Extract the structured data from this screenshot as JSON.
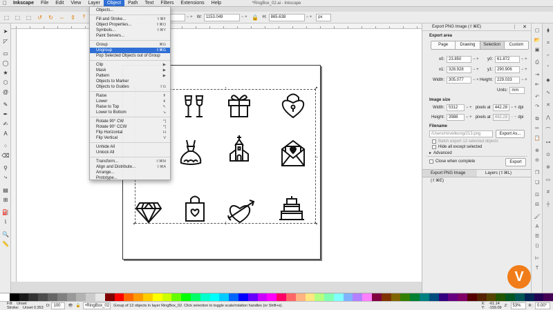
{
  "menubar": {
    "app": "Inkscape",
    "items": [
      "File",
      "Edit",
      "View",
      "Layer",
      "Object",
      "Path",
      "Text",
      "Filters",
      "Extensions",
      "Help"
    ],
    "active": "Object",
    "window_title": "*RingBox_02.ai - Inkscape"
  },
  "controls": {
    "x": "233.848",
    "w_label": "W:",
    "w": "1153.049",
    "h_label": "H:",
    "h": "865.638",
    "unit": "px"
  },
  "object_menu": [
    {
      "label": "Objects...",
      "shortcut": ""
    },
    {
      "sep": true
    },
    {
      "label": "Fill and Stroke...",
      "shortcut": "⇧⌘F"
    },
    {
      "label": "Object Properties...",
      "shortcut": "⇧⌘O"
    },
    {
      "label": "Symbols...",
      "shortcut": "⇧⌘Y"
    },
    {
      "label": "Paint Servers...",
      "shortcut": ""
    },
    {
      "sep": true
    },
    {
      "label": "Group",
      "shortcut": "⌘G"
    },
    {
      "label": "Ungroup",
      "shortcut": "⇧⌘G"
    },
    {
      "label": "Pop Selected Objects out of Group",
      "shortcut": ""
    },
    {
      "sep": true
    },
    {
      "label": "Clip",
      "shortcut": "▶"
    },
    {
      "label": "Mask",
      "shortcut": "▶"
    },
    {
      "label": "Pattern",
      "shortcut": "▶"
    },
    {
      "label": "Objects to Marker",
      "shortcut": ""
    },
    {
      "label": "Objects to Guides",
      "shortcut": "⇧G"
    },
    {
      "sep": true
    },
    {
      "label": "Raise",
      "shortcut": "⇞"
    },
    {
      "label": "Lower",
      "shortcut": "⇟"
    },
    {
      "label": "Raise to Top",
      "shortcut": "↖"
    },
    {
      "label": "Lower to Bottom",
      "shortcut": "↘"
    },
    {
      "sep": true
    },
    {
      "label": "Rotate 90° CW",
      "shortcut": "^]"
    },
    {
      "label": "Rotate 90° CCW",
      "shortcut": "^["
    },
    {
      "label": "Flip Horizontal",
      "shortcut": "H"
    },
    {
      "label": "Flip Vertical",
      "shortcut": "V"
    },
    {
      "sep": true
    },
    {
      "label": "Unhide All",
      "shortcut": ""
    },
    {
      "label": "Unlock All",
      "shortcut": ""
    },
    {
      "sep": true
    },
    {
      "label": "Transform...",
      "shortcut": "⇧⌘M"
    },
    {
      "label": "Align and Distribute...",
      "shortcut": "⇧⌘A"
    },
    {
      "label": "Arrange...",
      "shortcut": ""
    },
    {
      "label": "Prototype...",
      "shortcut": ""
    }
  ],
  "export_panel": {
    "title": "Export PNG Image (⇧⌘E)",
    "export_area_label": "Export area",
    "tabs": [
      "Page",
      "Drawing",
      "Selection",
      "Custom"
    ],
    "active_tab": "Selection",
    "x0_label": "x0:",
    "x0": "23.850",
    "y0_label": "y0:",
    "y0": "61.872",
    "x1_label": "x1:",
    "x1": "328.928",
    "y1_label": "y1:",
    "y1": "290.906",
    "width_label": "Width:",
    "width": "305.077",
    "height_label": "Height:",
    "height": "229.033",
    "units_label": "Units:",
    "units": "mm",
    "image_size_label": "Image size",
    "img_width_label": "Width:",
    "img_width": "5312",
    "img_height_label": "Height:",
    "img_height": "3988",
    "pixels_at_label": "pixels at",
    "dpi_x": "442.28",
    "dpi_y": "442.28",
    "dpi_label": "dpi",
    "filename_label": "Filename",
    "filename": "/Users/mrvellecng/213.png",
    "export_as_label": "Export As...",
    "batch_label": "Batch export 12 selected objects",
    "hide_label": "Hide all except selected",
    "advanced_label": "Advanced",
    "close_label": "Close when complete",
    "export_label": "Export",
    "bottom_tab_1": "Export PNG Image (⇧⌘E)",
    "bottom_tab_2": "Layers (⇧⌘L)"
  },
  "status": {
    "fill_label": "Fill:",
    "fill_value": "Unset",
    "stroke_label": "Stroke:",
    "stroke_value": "Unset 0.353",
    "opacity_label": "O:",
    "opacity": "100",
    "layer": "•RingBox_02",
    "message": "Group of 12 objects in layer RingBox_02. Click selection to toggle scale/rotation handles (or Shift+s).",
    "cursor_x_label": "X:",
    "cursor_x": "-61.14",
    "cursor_y_label": "Y:",
    "cursor_y": "-159.09",
    "zoom_label": "Z:",
    "zoom": "53%",
    "rotation_label": "R:",
    "rotation": "0.00°"
  },
  "icons": [
    "champagne-glasses-icon",
    "gift-box-icon",
    "heart-padlock-icon",
    "wedding-dress-icon",
    "chapel-icon",
    "love-letter-icon",
    "diamond-icon",
    "shopping-bag-icon",
    "heart-arrow-icon",
    "wedding-cake-icon"
  ],
  "palette": [
    "#ffffff",
    "#000000",
    "#1a1a1a",
    "#333333",
    "#4d4d4d",
    "#666666",
    "#808080",
    "#999999",
    "#b3b3b3",
    "#cccccc",
    "#e6e6e6",
    "#800000",
    "#ff0000",
    "#ff6600",
    "#ff9900",
    "#ffcc00",
    "#ffff00",
    "#ccff00",
    "#66ff00",
    "#00ff00",
    "#00ff66",
    "#00ffcc",
    "#00ffff",
    "#00ccff",
    "#0066ff",
    "#0000ff",
    "#6600ff",
    "#cc00ff",
    "#ff00ff",
    "#ff0066",
    "#ff6666",
    "#ffb380",
    "#ffe680",
    "#b3ff80",
    "#80ffb3",
    "#80ffff",
    "#80b3ff",
    "#b380ff",
    "#ff80ff",
    "#800040",
    "#803300",
    "#806600",
    "#338000",
    "#008033",
    "#008080",
    "#004d80",
    "#330080",
    "#660080",
    "#800066",
    "#550000",
    "#552200",
    "#554400",
    "#225500",
    "#005522",
    "#005555",
    "#002255",
    "#220055",
    "#440055"
  ]
}
